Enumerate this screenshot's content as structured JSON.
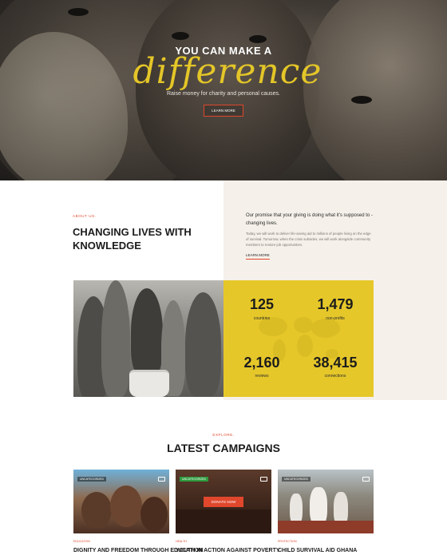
{
  "hero": {
    "title": "YOU CAN MAKE A",
    "script_word": "difference",
    "subtitle": "Raise money for charity and personal causes.",
    "button_label": "LEARN MORE"
  },
  "about": {
    "eyebrow": "ABOUT US.",
    "heading": "CHANGING LIVES WITH KNOWLEDGE",
    "promise": "Our promise that your giving is doing what it's supposed to - changing lives.",
    "body": "Today, we will work to deliver life-saving aid to millions of people living on the edge of survival. Tomorrow, when the crisis subsides, we will work alongside community members to restore job opportunities.",
    "link_label": "LEARN MORE"
  },
  "stats": [
    {
      "value": "125",
      "label": "countries"
    },
    {
      "value": "1,479",
      "label": "non-profits"
    },
    {
      "value": "2,160",
      "label": "reviews"
    },
    {
      "value": "38,415",
      "label": "connections"
    }
  ],
  "campaigns": {
    "eyebrow": "EXPLORE.",
    "heading": "LATEST CAMPAIGNS",
    "items": [
      {
        "tag": "UNCATEGORIZED",
        "category": "EDUCATION",
        "title": "DIGNITY AND FREEDOM THROUGH EDUCATION"
      },
      {
        "tag": "UNCATEGORIZED",
        "category": "HEALTH",
        "title": "YOUTH IN ACTION AGAINST POVERTY",
        "button": "DONATE NOW"
      },
      {
        "tag": "UNCATEGORIZED",
        "category": "PROTECTION",
        "title": "CHILD SURVIVAL AID GHANA"
      }
    ]
  },
  "colors": {
    "accent": "#e0472c",
    "yellow": "#e6c72a",
    "script": "#e4c628",
    "cream": "#f5f1ea"
  },
  "icons": {
    "card_icon": "camera-icon"
  }
}
